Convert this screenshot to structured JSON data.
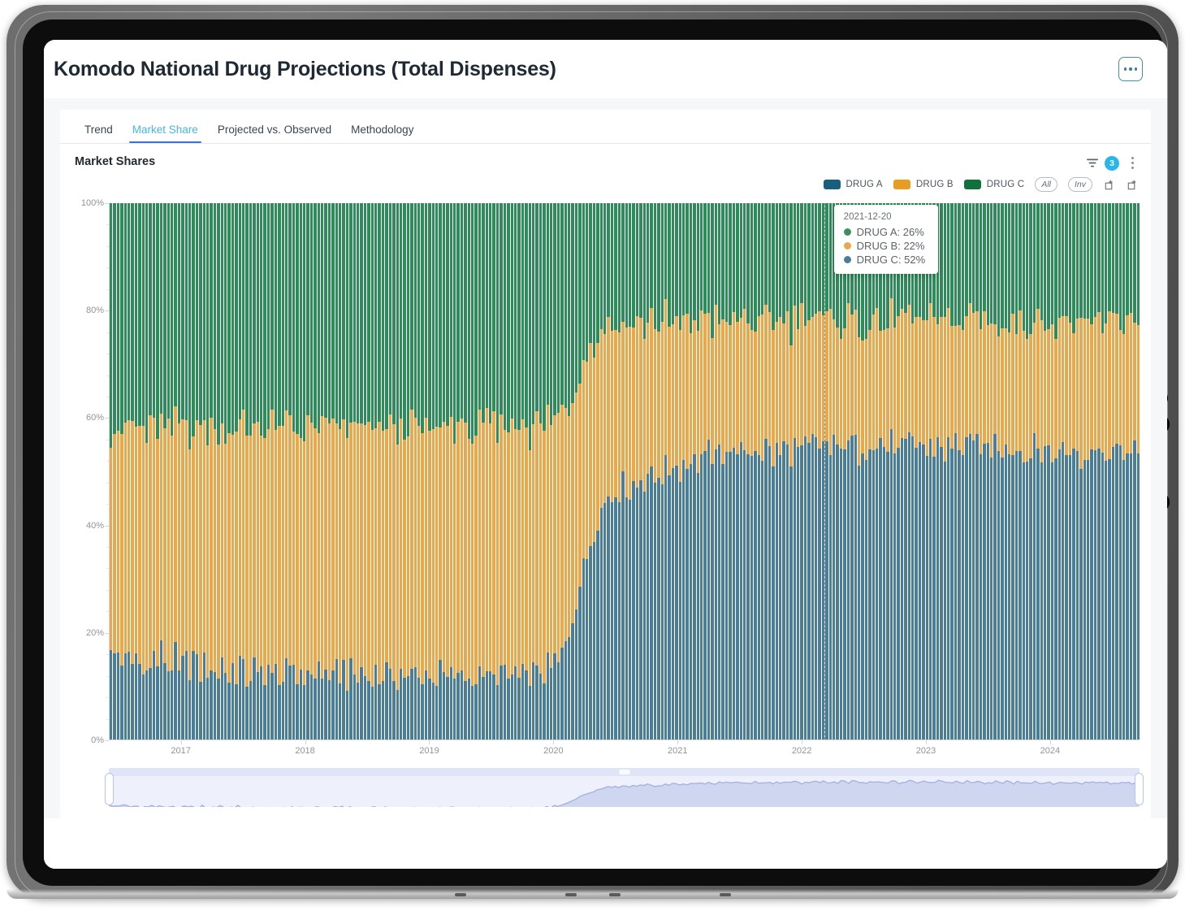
{
  "header": {
    "title": "Komodo National Drug Projections (Total Dispenses)",
    "overflow_label": "..."
  },
  "tabs": [
    {
      "label": "Trend",
      "active": false
    },
    {
      "label": "Market Share",
      "active": true
    },
    {
      "label": "Projected vs. Observed",
      "active": false
    },
    {
      "label": "Methodology",
      "active": false
    }
  ],
  "chart_header": {
    "title": "Market Shares",
    "filter_icon": "filter-icon",
    "filter_badge": "3",
    "kebab_icon": "more-vertical-icon"
  },
  "legend": {
    "items": [
      {
        "label": "DRUG A",
        "color": "#17607d"
      },
      {
        "label": "DRUG B",
        "color": "#e89c22"
      },
      {
        "label": "DRUG C",
        "color": "#10713c"
      }
    ],
    "all_label": "All",
    "inv_label": "Inv",
    "select_icon": "select-add-icon",
    "deselect_icon": "select-remove-icon"
  },
  "tooltip": {
    "date": "2021-12-20",
    "rows": [
      {
        "label": "DRUG A: 26%",
        "color": "#3f8f5e"
      },
      {
        "label": "DRUG B: 22%",
        "color": "#e8a84e"
      },
      {
        "label": "DRUG C: 52%",
        "color": "#4a7e96"
      }
    ]
  },
  "chart_data": {
    "type": "bar",
    "title": "Market Shares",
    "subtitle": "",
    "xlabel": "",
    "ylabel": "",
    "stacked": true,
    "stack_order_bottom_to_top": [
      "DRUG C",
      "DRUG B",
      "DRUG A"
    ],
    "ylim": [
      0,
      100
    ],
    "ytick_labels": [
      "0%",
      "20%",
      "40%",
      "60%",
      "80%",
      "100%"
    ],
    "ytick_values": [
      0,
      20,
      40,
      60,
      80,
      100
    ],
    "xtick_labels": [
      "2017",
      "2018",
      "2019",
      "2020",
      "2021",
      "2022",
      "2023",
      "2024"
    ],
    "x_range": [
      "2016-08",
      "2024-07"
    ],
    "grid": false,
    "legend_position": "top-right",
    "series": [
      {
        "name": "DRUG C",
        "color": "#4a7e96",
        "values": [
          18,
          15,
          16,
          14,
          17,
          15,
          13,
          16,
          14,
          12,
          15,
          13,
          16,
          14,
          17,
          15,
          13,
          14,
          16,
          12,
          14,
          15,
          13,
          16,
          14,
          12,
          15,
          13,
          11,
          14,
          12,
          15,
          13,
          11,
          14,
          12,
          15,
          13,
          11,
          12,
          14,
          11,
          13,
          12,
          14,
          11,
          13,
          12,
          11,
          13,
          12,
          14,
          11,
          13,
          12,
          11,
          13,
          12,
          14,
          11,
          13,
          12,
          11,
          13,
          12,
          14,
          11,
          13,
          12,
          11,
          13,
          12,
          11,
          12,
          13,
          11,
          12,
          13,
          11,
          12,
          11,
          13,
          12,
          11,
          12,
          13,
          11,
          12,
          13,
          11,
          12,
          11,
          13,
          12,
          11,
          12,
          12,
          11,
          13,
          12,
          11,
          12,
          11,
          12,
          13,
          11,
          12,
          11,
          12,
          13,
          12,
          11,
          12,
          13,
          11,
          12,
          11,
          12,
          13,
          12,
          13,
          12,
          14,
          13,
          15,
          14,
          16,
          18,
          20,
          23,
          26,
          29,
          32,
          34,
          37,
          39,
          41,
          43,
          44,
          46,
          45,
          47,
          46,
          48,
          47,
          46,
          48,
          47,
          49,
          48,
          50,
          49,
          48,
          50,
          49,
          51,
          50,
          52,
          51,
          50,
          52,
          51,
          53,
          52,
          51,
          53,
          52,
          54,
          53,
          52,
          54,
          53,
          55,
          54,
          53,
          55,
          54,
          52,
          54,
          53,
          55,
          54,
          53,
          55,
          54,
          52,
          54,
          53,
          55,
          54,
          53,
          55,
          54,
          53,
          55,
          54,
          56,
          55,
          54,
          56,
          55,
          53,
          55,
          54,
          56,
          55,
          54,
          56,
          55,
          53,
          55,
          54,
          56,
          55,
          54,
          56,
          55,
          54,
          56,
          55,
          53,
          55,
          54,
          56,
          55,
          54,
          56,
          55,
          53,
          55,
          54,
          56,
          55,
          53,
          55,
          54,
          56,
          55,
          54,
          56,
          55,
          54,
          56,
          55,
          53,
          55,
          54,
          56,
          55,
          54,
          56,
          55,
          53,
          55,
          54,
          52,
          54,
          53,
          55,
          54,
          53,
          55,
          54,
          52,
          54,
          53,
          55,
          54,
          53,
          55,
          54,
          52,
          54,
          53,
          55,
          54,
          53,
          55,
          54,
          52,
          54,
          53,
          55,
          54,
          53,
          52,
          54,
          53
        ]
      },
      {
        "name": "DRUG B",
        "color": "#e8a84e",
        "values": [
          40,
          43,
          42,
          44,
          41,
          43,
          45,
          42,
          44,
          46,
          43,
          45,
          42,
          44,
          41,
          43,
          45,
          44,
          42,
          46,
          44,
          43,
          45,
          42,
          44,
          46,
          43,
          45,
          47,
          44,
          46,
          43,
          45,
          47,
          44,
          46,
          43,
          45,
          47,
          46,
          44,
          47,
          45,
          46,
          44,
          47,
          45,
          46,
          47,
          45,
          46,
          44,
          47,
          45,
          46,
          47,
          45,
          46,
          44,
          47,
          45,
          46,
          47,
          45,
          46,
          44,
          47,
          45,
          46,
          47,
          45,
          46,
          47,
          46,
          45,
          47,
          46,
          45,
          47,
          46,
          47,
          45,
          46,
          47,
          46,
          45,
          47,
          46,
          45,
          47,
          46,
          47,
          45,
          46,
          47,
          46,
          46,
          47,
          45,
          46,
          47,
          46,
          47,
          46,
          45,
          47,
          46,
          47,
          46,
          45,
          46,
          47,
          46,
          45,
          47,
          46,
          47,
          46,
          45,
          46,
          46,
          47,
          45,
          46,
          44,
          46,
          45,
          44,
          43,
          42,
          41,
          40,
          39,
          38,
          37,
          36,
          35,
          34,
          33,
          32,
          33,
          31,
          32,
          30,
          31,
          32,
          30,
          31,
          29,
          30,
          28,
          29,
          30,
          28,
          29,
          27,
          28,
          26,
          27,
          28,
          26,
          27,
          25,
          26,
          27,
          25,
          26,
          24,
          25,
          26,
          24,
          25,
          23,
          24,
          25,
          23,
          24,
          26,
          24,
          25,
          23,
          24,
          25,
          23,
          24,
          26,
          24,
          25,
          23,
          24,
          25,
          23,
          24,
          25,
          23,
          24,
          22,
          23,
          24,
          22,
          23,
          25,
          23,
          24,
          22,
          23,
          24,
          22,
          23,
          25,
          23,
          24,
          22,
          23,
          24,
          22,
          23,
          24,
          22,
          23,
          25,
          23,
          24,
          22,
          23,
          24,
          22,
          23,
          25,
          23,
          24,
          22,
          23,
          25,
          23,
          24,
          22,
          23,
          24,
          22,
          23,
          24,
          22,
          23,
          25,
          23,
          24,
          22,
          23,
          24,
          22,
          23,
          25,
          23,
          24,
          26,
          24,
          25,
          23,
          24,
          25,
          23,
          24,
          26,
          24,
          25,
          23,
          24,
          25,
          23,
          24,
          26,
          24,
          25,
          23,
          24,
          25,
          23,
          24,
          26,
          24,
          25,
          23,
          24,
          25,
          26,
          24,
          25
        ]
      },
      {
        "name": "DRUG A",
        "color": "#2e8b5a",
        "values": [
          42,
          42,
          42,
          42,
          42,
          42,
          42,
          42,
          42,
          42,
          42,
          42,
          42,
          42,
          42,
          42,
          42,
          42,
          42,
          42,
          42,
          42,
          42,
          42,
          42,
          42,
          42,
          42,
          42,
          42,
          42,
          42,
          42,
          42,
          42,
          42,
          42,
          42,
          42,
          42,
          42,
          42,
          42,
          42,
          42,
          42,
          42,
          42,
          42,
          42,
          42,
          42,
          42,
          42,
          42,
          42,
          42,
          42,
          42,
          42,
          42,
          42,
          42,
          42,
          42,
          42,
          42,
          42,
          42,
          42,
          42,
          42,
          42,
          42,
          42,
          42,
          42,
          42,
          42,
          42,
          42,
          42,
          42,
          42,
          42,
          42,
          42,
          42,
          42,
          42,
          42,
          42,
          42,
          42,
          42,
          42,
          42,
          42,
          42,
          42,
          42,
          42,
          42,
          42,
          42,
          42,
          42,
          42,
          42,
          42,
          42,
          42,
          42,
          42,
          42,
          42,
          42,
          42,
          42,
          42,
          41,
          41,
          41,
          41,
          41,
          40,
          39,
          38,
          37,
          35,
          33,
          31,
          29,
          28,
          26,
          25,
          24,
          23,
          23,
          22,
          22,
          22,
          22,
          22,
          22,
          22,
          22,
          22,
          22,
          22,
          22,
          22,
          22,
          22,
          22,
          22,
          22,
          22,
          22,
          22,
          22,
          22,
          22,
          22,
          22,
          22,
          22,
          22,
          22,
          22,
          22,
          22,
          22,
          22,
          22,
          22,
          22,
          22,
          22,
          22,
          22,
          22,
          22,
          22,
          22,
          22,
          22,
          22,
          22,
          22,
          22,
          22,
          22,
          22,
          22,
          22,
          22,
          22,
          22,
          22,
          22,
          22,
          22,
          22,
          22,
          22,
          22,
          22,
          22,
          22,
          22,
          22,
          22,
          22,
          22,
          22,
          22,
          22,
          22,
          22,
          22,
          22,
          22,
          22,
          22,
          22,
          22,
          22,
          22,
          22,
          22,
          22,
          22,
          22,
          22,
          22,
          22,
          22,
          22,
          22,
          22,
          22,
          22,
          22,
          22,
          22,
          22,
          22,
          22,
          22,
          22,
          22,
          22,
          22,
          22,
          22,
          22,
          22,
          22,
          22,
          22,
          22,
          22,
          22,
          22,
          22,
          22,
          22,
          22,
          22,
          22,
          22,
          22,
          22,
          22,
          22,
          22,
          22,
          22,
          22,
          22,
          22,
          22,
          22,
          22,
          22,
          22,
          22
        ]
      }
    ],
    "annotations": [
      {
        "type": "cursor-line",
        "x": "2021-12-20",
        "style": "dashed"
      }
    ]
  },
  "brush": {
    "name": "range-slider",
    "left_handle": "brush-handle-left",
    "right_handle": "brush-handle-right"
  }
}
